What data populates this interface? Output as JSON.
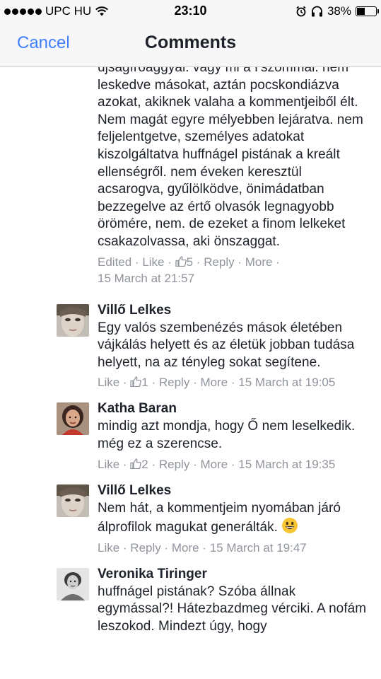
{
  "status_bar": {
    "carrier": "UPC HU",
    "time": "23:10",
    "battery_percent": "38%",
    "battery_level": 0.38,
    "icons": [
      "signal-dots-icon",
      "wifi-icon",
      "alarm-icon",
      "headphones-icon",
      "battery-icon"
    ]
  },
  "nav": {
    "cancel_label": "Cancel",
    "title": "Comments",
    "accent_color": "#4080ff"
  },
  "comments": [
    {
      "author": "",
      "text": "újságíróaggyal. vagy mi a f'szommal. nem leskedve másokat, aztán pocskondiázva azokat, akiknek valaha a kommentjeiből élt. Nem magát egyre mélyebben lejáratva. nem feljelentgetve, személyes adatokat kiszolgáltatva huffnágel pistának a kreált ellenségről. nem éveken keresztül acsarogva, gyűlölködve, önimádatban bezzegelve az értő olvasók legnagyobb örömére, nem. de ezeket a finom lelkeket csakazolvassa, aki önszaggat.",
      "meta": {
        "edited": "Edited",
        "like": "Like",
        "likes": "5",
        "reply": "Reply",
        "more": "More",
        "time": "15 March at 21:57"
      }
    },
    {
      "author": "Villő Lelkes",
      "text": "Egy valós szembenézés mások életében vájkálás helyett és az életük jobban tudása helyett, na az tényleg sokat segítene.",
      "meta": {
        "like": "Like",
        "likes": "1",
        "reply": "Reply",
        "more": "More",
        "time": "15 March at 19:05"
      }
    },
    {
      "author": "Katha Baran",
      "text": "mindig azt mondja, hogy Ő nem leselkedik. még ez a szerencse.",
      "meta": {
        "like": "Like",
        "likes": "2",
        "reply": "Reply",
        "more": "More",
        "time": "15 March at 19:35"
      }
    },
    {
      "author": "Villő Lelkes",
      "text": "Nem hát, a kommentjeim nyomában járó álprofilok magukat generálták.",
      "meta": {
        "like": "Like",
        "reply": "Reply",
        "more": "More",
        "time": "15 March at 19:47"
      }
    },
    {
      "author": "Veronika Tiringer",
      "text": "huffnágel pistának? Szóba állnak egymással?! Hátezbazdmeg vérciki. A nofám leszokod. Mindezt úgy, hogy"
    }
  ]
}
